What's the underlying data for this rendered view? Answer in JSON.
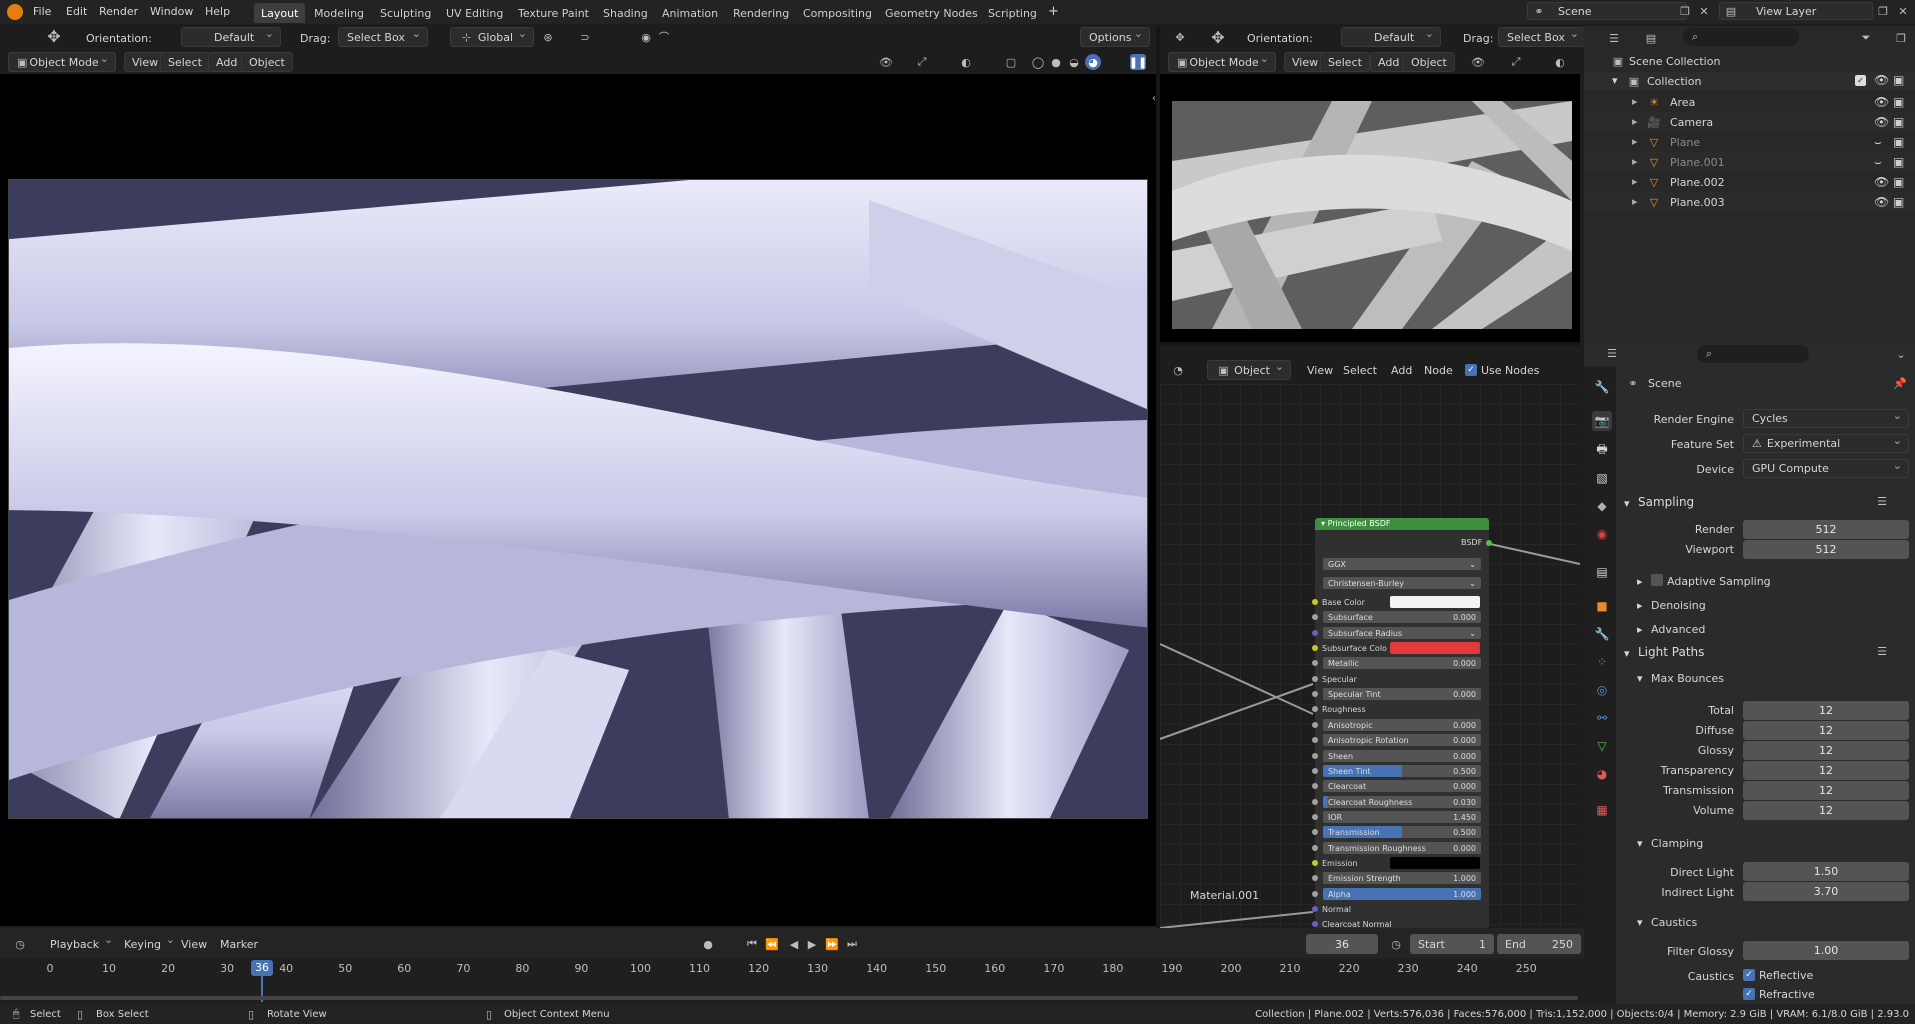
{
  "menu": {
    "file": "File",
    "edit": "Edit",
    "render": "Render",
    "window": "Window",
    "help": "Help"
  },
  "workspaces": [
    "Layout",
    "Modeling",
    "Sculpting",
    "UV Editing",
    "Texture Paint",
    "Shading",
    "Animation",
    "Rendering",
    "Compositing",
    "Geometry Nodes",
    "Scripting"
  ],
  "add_tab": "+",
  "top_right": {
    "scene": "Scene",
    "view_layer": "View Layer"
  },
  "viewport": {
    "orientation_label": "Orientation:",
    "orientation_value": "Default",
    "drag_label": "Drag:",
    "drag_value": "Select Box",
    "transform": "Global",
    "options": "Options",
    "mode": "Object Mode",
    "view": "View",
    "select": "Select",
    "add": "Add",
    "object": "Object"
  },
  "right_viewport": {
    "orientation_label": "Orientation:",
    "orientation_value": "Default",
    "drag_label": "Drag:",
    "drag_value": "Select Box",
    "mode": "Object Mode",
    "view": "View",
    "select": "Select",
    "add": "Add",
    "object": "Object"
  },
  "node_editor": {
    "type": "Object",
    "view": "View",
    "select": "Select",
    "add": "Add",
    "node": "Node",
    "use_nodes": "Use Nodes",
    "material": "Material.001",
    "node_title": "Principled BSDF",
    "output": "BSDF",
    "distribution": "GGX",
    "subsurface_method": "Christensen-Burley",
    "rows": [
      {
        "label": "Base Color",
        "type": "color",
        "color": "#f2f2f2",
        "sock": "#c7c729"
      },
      {
        "label": "Subsurface",
        "value": "0.000",
        "sock": "#a1a1a1"
      },
      {
        "label": "Subsurface Radius",
        "type": "drop",
        "sock": "#6363c7"
      },
      {
        "label": "Subsurface Colo",
        "type": "color",
        "color": "#e03a3a",
        "sock": "#c7c729"
      },
      {
        "label": "Metallic",
        "value": "0.000",
        "sock": "#a1a1a1"
      },
      {
        "label": "Specular",
        "type": "plain",
        "sock": "#a1a1a1"
      },
      {
        "label": "Specular Tint",
        "value": "0.000",
        "sock": "#a1a1a1"
      },
      {
        "label": "Roughness",
        "type": "plain",
        "sock": "#a1a1a1"
      },
      {
        "label": "Anisotropic",
        "value": "0.000",
        "sock": "#a1a1a1"
      },
      {
        "label": "Anisotropic Rotation",
        "value": "0.000",
        "sock": "#a1a1a1"
      },
      {
        "label": "Sheen",
        "value": "0.000",
        "sock": "#a1a1a1"
      },
      {
        "label": "Sheen Tint",
        "value": "0.500",
        "fill": 0.5,
        "sock": "#a1a1a1"
      },
      {
        "label": "Clearcoat",
        "value": "0.000",
        "sock": "#a1a1a1"
      },
      {
        "label": "Clearcoat Roughness",
        "value": "0.030",
        "fill": 0.03,
        "sock": "#a1a1a1"
      },
      {
        "label": "IOR",
        "value": "1.450",
        "sock": "#a1a1a1"
      },
      {
        "label": "Transmission",
        "value": "0.500",
        "fill": 0.5,
        "sock": "#a1a1a1"
      },
      {
        "label": "Transmission Roughness",
        "value": "0.000",
        "sock": "#a1a1a1"
      },
      {
        "label": "Emission",
        "type": "color",
        "color": "#000000",
        "sock": "#c7c729"
      },
      {
        "label": "Emission Strength",
        "value": "1.000",
        "sock": "#a1a1a1"
      },
      {
        "label": "Alpha",
        "value": "1.000",
        "fill": 1.0,
        "sock": "#a1a1a1"
      },
      {
        "label": "Normal",
        "type": "plain",
        "sock": "#6363c7"
      },
      {
        "label": "Clearcoat Normal",
        "type": "plain",
        "sock": "#6363c7"
      }
    ]
  },
  "outliner": {
    "root": "Scene Collection",
    "collection": "Collection",
    "items": [
      {
        "name": "Area",
        "dim": false
      },
      {
        "name": "Camera",
        "dim": false
      },
      {
        "name": "Plane",
        "dim": true
      },
      {
        "name": "Plane.001",
        "dim": true
      },
      {
        "name": "Plane.002",
        "dim": false
      },
      {
        "name": "Plane.003",
        "dim": false
      }
    ]
  },
  "properties": {
    "scene": "Scene",
    "render_engine_label": "Render Engine",
    "render_engine": "Cycles",
    "feature_set_label": "Feature Set",
    "feature_set": "Experimental",
    "device_label": "Device",
    "device": "GPU Compute",
    "sampling": "Sampling",
    "render_label": "Render",
    "render_value": "512",
    "viewport_label": "Viewport",
    "viewport_value": "512",
    "adaptive_sampling": "Adaptive Sampling",
    "denoising": "Denoising",
    "advanced": "Advanced",
    "light_paths": "Light Paths",
    "max_bounces": "Max Bounces",
    "bounces": [
      {
        "label": "Total",
        "value": "12"
      },
      {
        "label": "Diffuse",
        "value": "12"
      },
      {
        "label": "Glossy",
        "value": "12"
      },
      {
        "label": "Transparency",
        "value": "12"
      },
      {
        "label": "Transmission",
        "value": "12"
      },
      {
        "label": "Volume",
        "value": "12"
      }
    ],
    "clamping": "Clamping",
    "direct_label": "Direct Light",
    "direct_value": "1.50",
    "indirect_label": "Indirect Light",
    "indirect_value": "3.70",
    "caustics": "Caustics",
    "filter_glossy_label": "Filter Glossy",
    "filter_glossy_value": "1.00",
    "caustics_label": "Caustics",
    "reflective": "Reflective",
    "refractive": "Refractive"
  },
  "timeline": {
    "playback": "Playback",
    "keying": "Keying",
    "view": "View",
    "marker": "Marker",
    "current": "36",
    "start_label": "Start",
    "start": "1",
    "end_label": "End",
    "end": "250",
    "ticks": [
      "0",
      "10",
      "20",
      "30",
      "40",
      "50",
      "60",
      "70",
      "80",
      "90",
      "100",
      "110",
      "120",
      "130",
      "140",
      "150",
      "160",
      "170",
      "180",
      "190",
      "200",
      "210",
      "220",
      "230",
      "240",
      "250"
    ]
  },
  "status": {
    "select": "Select",
    "box_select": "Box Select",
    "rotate": "Rotate View",
    "context": "Object Context Menu",
    "stats": "Collection | Plane.002 | Verts:576,036 | Faces:576,000 | Tris:1,152,000 | Objects:0/4 | Memory: 2.9 GiB | VRAM: 6.1/8.0 GiB | 2.93.0"
  }
}
